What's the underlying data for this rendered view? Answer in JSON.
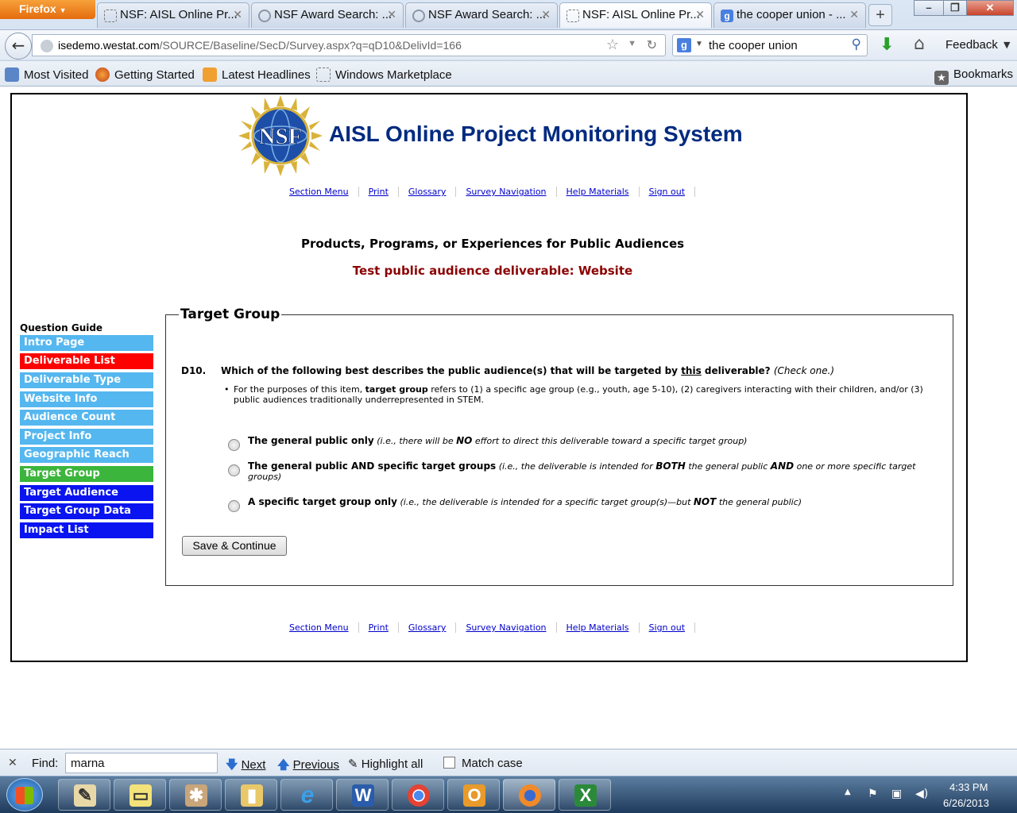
{
  "browser": {
    "menu_button": "Firefox",
    "tabs": [
      {
        "title": "NSF: AISL Online Pr...",
        "active": false,
        "icon": "dashed-page-icon"
      },
      {
        "title": "NSF Award Search: ...",
        "active": false,
        "icon": "nsf-cog-icon"
      },
      {
        "title": "NSF Award Search: ...",
        "active": false,
        "icon": "nsf-cog-icon"
      },
      {
        "title": "NSF: AISL Online Pr...",
        "active": true,
        "icon": "dashed-page-icon"
      },
      {
        "title": "the cooper union - ...",
        "active": false,
        "icon": "google-icon"
      }
    ],
    "new_tab": "+",
    "url_domain": "isedemo.westat.com",
    "url_path": "/SOURCE/Baseline/SecD/Survey.aspx?q=qD10&DelivId=166",
    "search_value": "the cooper union",
    "search_engine_letter": "g",
    "feedback": "Feedback",
    "bookmarks": [
      {
        "label": "Most Visited"
      },
      {
        "label": "Getting Started"
      },
      {
        "label": "Latest Headlines"
      },
      {
        "label": "Windows Marketplace"
      }
    ],
    "bookmarks_menu": "Bookmarks"
  },
  "page": {
    "site_title": "AISL Online Project Monitoring System",
    "logo_text": "NSF",
    "nav_links": [
      "Section Menu",
      "Print",
      "Glossary",
      "Survey Navigation",
      "Help Materials",
      "Sign out"
    ],
    "section_heading": "Products, Programs, or Experiences for Public Audiences",
    "deliverable_heading": "Test public audience deliverable: Website",
    "question_guide": {
      "title": "Question Guide",
      "items": [
        {
          "label": "Intro Page",
          "state": "light"
        },
        {
          "label": "Deliverable List",
          "state": "red"
        },
        {
          "label": "Deliverable Type",
          "state": "light"
        },
        {
          "label": "Website Info",
          "state": "light"
        },
        {
          "label": "Audience Count",
          "state": "light"
        },
        {
          "label": "Project Info",
          "state": "light"
        },
        {
          "label": "Geographic Reach",
          "state": "light"
        },
        {
          "label": "Target Group",
          "state": "green"
        },
        {
          "label": "Target Audience",
          "state": "blue"
        },
        {
          "label": "Target Group Data",
          "state": "blue"
        },
        {
          "label": "Impact List",
          "state": "blue"
        }
      ]
    },
    "fieldset_legend": "Target Group",
    "question": {
      "number": "D10.",
      "text_before": "Which of the following best describes the public audience(s) that will be targeted by ",
      "text_underlined": "this",
      "text_after": " deliverable?",
      "hint": "(Check one.)",
      "note_bullet": "•",
      "note_before": "For the purposes of this item, ",
      "note_bold": "target group",
      "note_after": " refers to (1) a specific age group (e.g., youth, age 5-10), (2) caregivers interacting with their children, and/or (3) public audiences traditionally underrepresented in STEM."
    },
    "options": [
      {
        "label": "The general public only",
        "detail_parts": [
          "(i.e., there will be ",
          "NO",
          " effort to direct this deliverable toward a specific target group)"
        ]
      },
      {
        "label": "The general public AND specific target groups",
        "detail_parts": [
          "(i.e., the deliverable is intended for ",
          "BOTH",
          " the general public ",
          "AND",
          " one or more specific target groups)"
        ]
      },
      {
        "label": "A specific target group only",
        "detail_parts": [
          "(i.e., the deliverable is intended for a specific target group(s)—but ",
          "NOT",
          " the general public)"
        ]
      }
    ],
    "save_button": "Save & Continue"
  },
  "findbar": {
    "close": "✕",
    "label": "Find:",
    "value": "marna",
    "next": "Next",
    "previous": "Previous",
    "highlight_all": "Highlight all",
    "match_case": "Match case"
  },
  "taskbar": {
    "time": "4:33 PM",
    "date": "6/26/2013"
  },
  "colors": {
    "title_blue": "#002a80",
    "deliverable_red": "#8b0000",
    "guide_light": "#55b7ef",
    "guide_red": "#ff0000",
    "guide_green": "#3bb53b",
    "guide_blue": "#0a14f0"
  }
}
